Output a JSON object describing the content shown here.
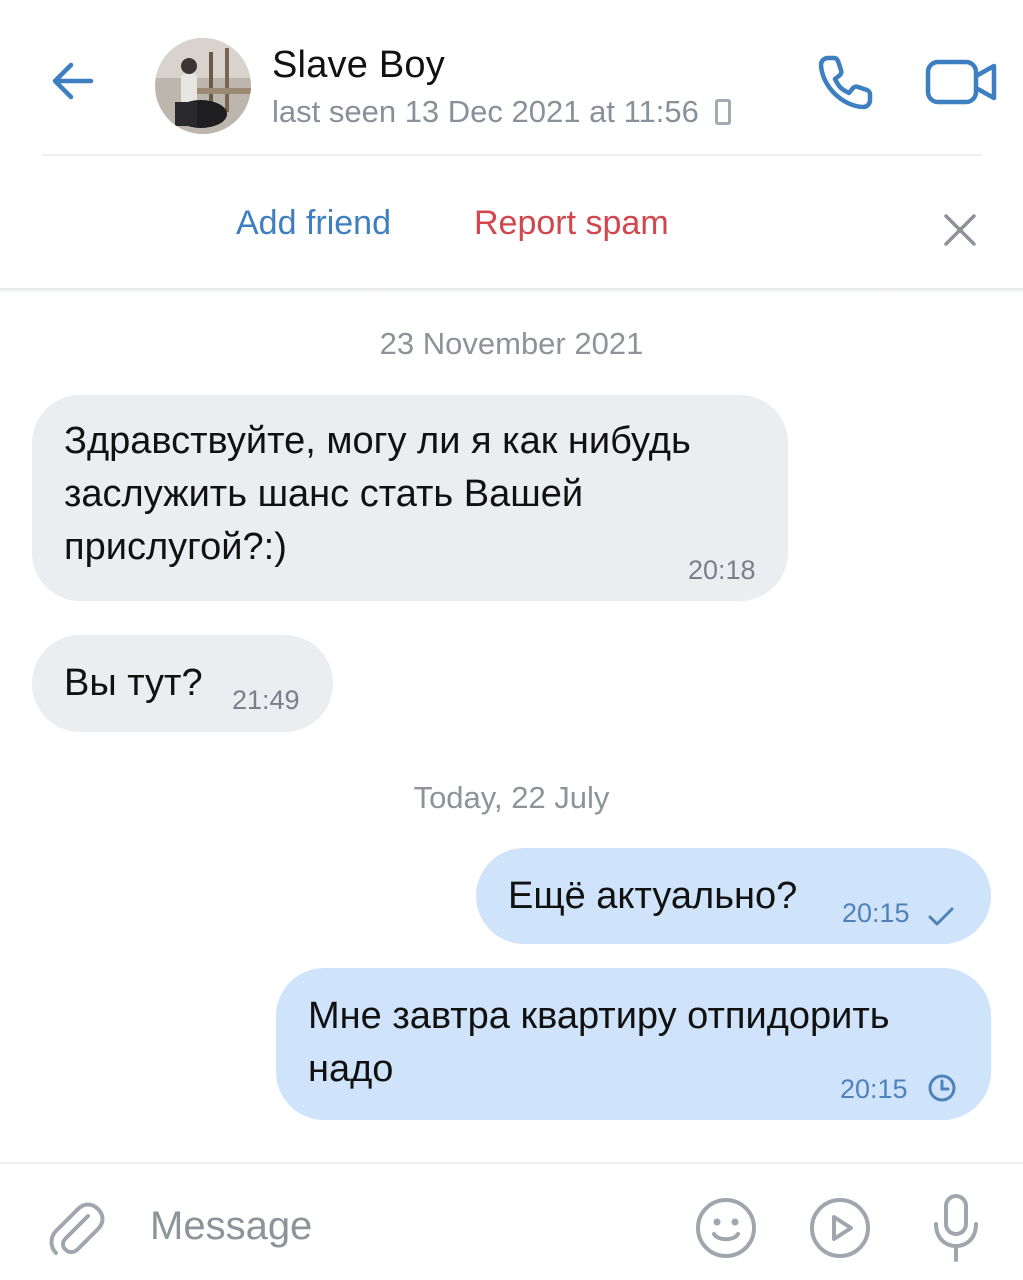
{
  "header": {
    "back_icon": "arrow-left-icon",
    "contact_name": "Slave Boy",
    "last_seen": "last seen 13 Dec 2021 at 11:56",
    "device_icon": "mobile-device-icon",
    "call_icon": "phone-icon",
    "video_icon": "video-camera-icon"
  },
  "action_bar": {
    "add_friend": "Add friend",
    "report_spam": "Report spam",
    "dismiss_icon": "close-icon"
  },
  "messages": [
    {
      "type": "date",
      "text": "23 November 2021"
    },
    {
      "type": "incoming",
      "text": "Здравствуйте, могу ли я как нибудь\nзаслужить шанс стать Вашей\nприслугой?:)",
      "time": "20:18"
    },
    {
      "type": "incoming",
      "text": "Вы тут?",
      "time": "21:49"
    },
    {
      "type": "date",
      "text": "Today, 22 July"
    },
    {
      "type": "outgoing",
      "text": "Ещё актуально?",
      "time": "20:15",
      "status_icon": "checkmark-icon"
    },
    {
      "type": "outgoing",
      "text": "Мне завтра квартиру отпидорить\nнадо",
      "time": "20:15",
      "status_icon": "clock-icon"
    }
  ],
  "composer": {
    "attach_icon": "paperclip-icon",
    "placeholder": "Message",
    "emoji_icon": "smiley-icon",
    "video_message_icon": "play-circle-icon",
    "mic_icon": "microphone-icon"
  },
  "colors": {
    "accent": "#3d7fc0",
    "danger": "#d1474d",
    "incoming_bubble": "#ecedf0",
    "outgoing_bubble": "#cfe4fb"
  }
}
